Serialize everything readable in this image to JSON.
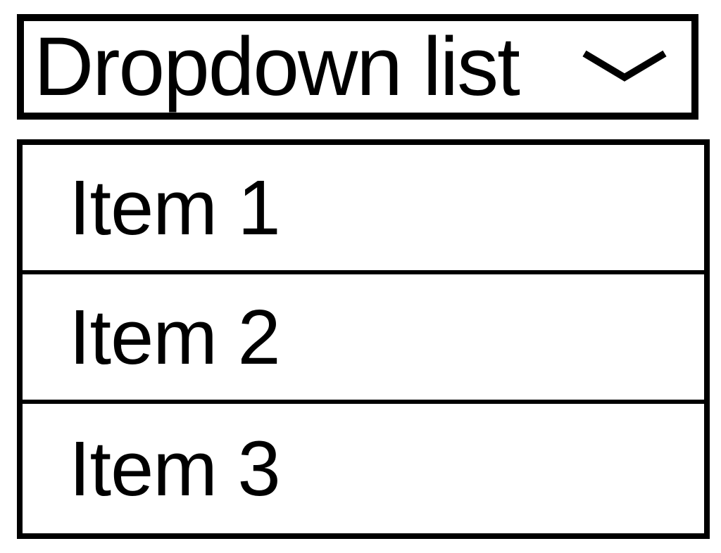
{
  "dropdown": {
    "label": "Dropdown list",
    "items": [
      {
        "label": "Item 1"
      },
      {
        "label": "Item 2"
      },
      {
        "label": "Item 3"
      }
    ]
  }
}
